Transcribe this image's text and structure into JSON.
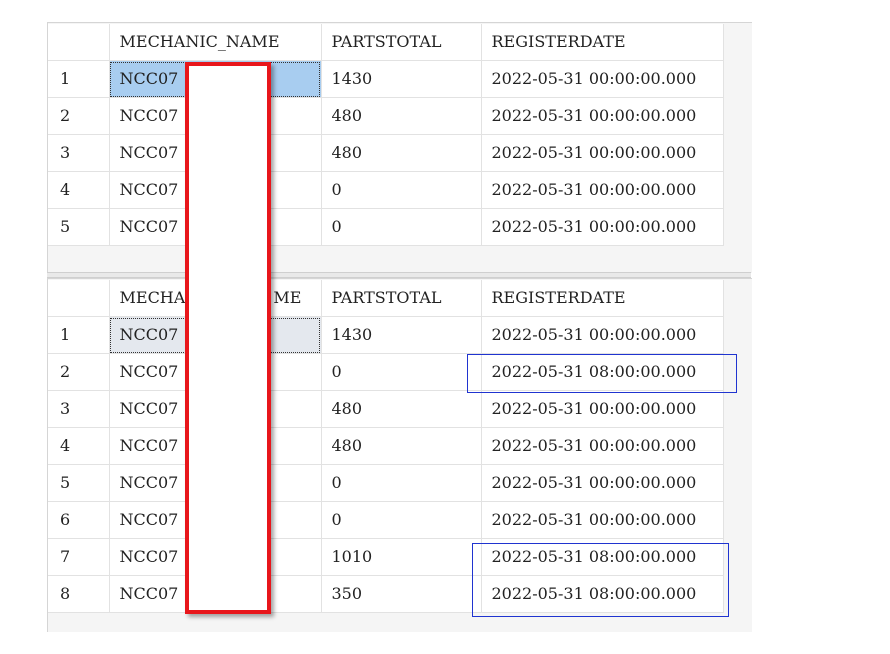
{
  "result_sets": [
    {
      "columns": [
        "",
        "MECHANIC_NAME",
        "PARTSTOTAL",
        "REGISTERDATE"
      ],
      "rows": [
        {
          "n": "1",
          "name": "NCC07",
          "parts": "1430",
          "date": "2022-05-31 00:00:00.000"
        },
        {
          "n": "2",
          "name": "NCC07",
          "parts": "480",
          "date": "2022-05-31 00:00:00.000"
        },
        {
          "n": "3",
          "name": "NCC07",
          "parts": "480",
          "date": "2022-05-31 00:00:00.000"
        },
        {
          "n": "4",
          "name": "NCC07",
          "parts": "0",
          "date": "2022-05-31 00:00:00.000"
        },
        {
          "n": "5",
          "name": "NCC07",
          "parts": "0",
          "date": "2022-05-31 00:00:00.000"
        }
      ]
    },
    {
      "columns": [
        "",
        "MECHA",
        "ME",
        "PARTSTOTAL",
        "REGISTERDATE"
      ],
      "rows": [
        {
          "n": "1",
          "name": "NCC07",
          "parts": "1430",
          "date": "2022-05-31 00:00:00.000"
        },
        {
          "n": "2",
          "name": "NCC07",
          "parts": "0",
          "date": "2022-05-31 08:00:00.000"
        },
        {
          "n": "3",
          "name": "NCC07",
          "parts": "480",
          "date": "2022-05-31 00:00:00.000"
        },
        {
          "n": "4",
          "name": "NCC07",
          "parts": "480",
          "date": "2022-05-31 00:00:00.000"
        },
        {
          "n": "5",
          "name": "NCC07",
          "parts": "0",
          "date": "2022-05-31 00:00:00.000"
        },
        {
          "n": "6",
          "name": "NCC07",
          "parts": "0",
          "date": "2022-05-31 00:00:00.000"
        },
        {
          "n": "7",
          "name": "NCC07",
          "parts": "1010",
          "date": "2022-05-31 08:00:00.000"
        },
        {
          "n": "8",
          "name": "NCC07",
          "parts": "350",
          "date": "2022-05-31 08:00:00.000"
        }
      ]
    }
  ],
  "colors": {
    "redaction_border": "#e8161b",
    "highlight_border": "#2034d0",
    "selected_cell": "#a8cdf0"
  }
}
